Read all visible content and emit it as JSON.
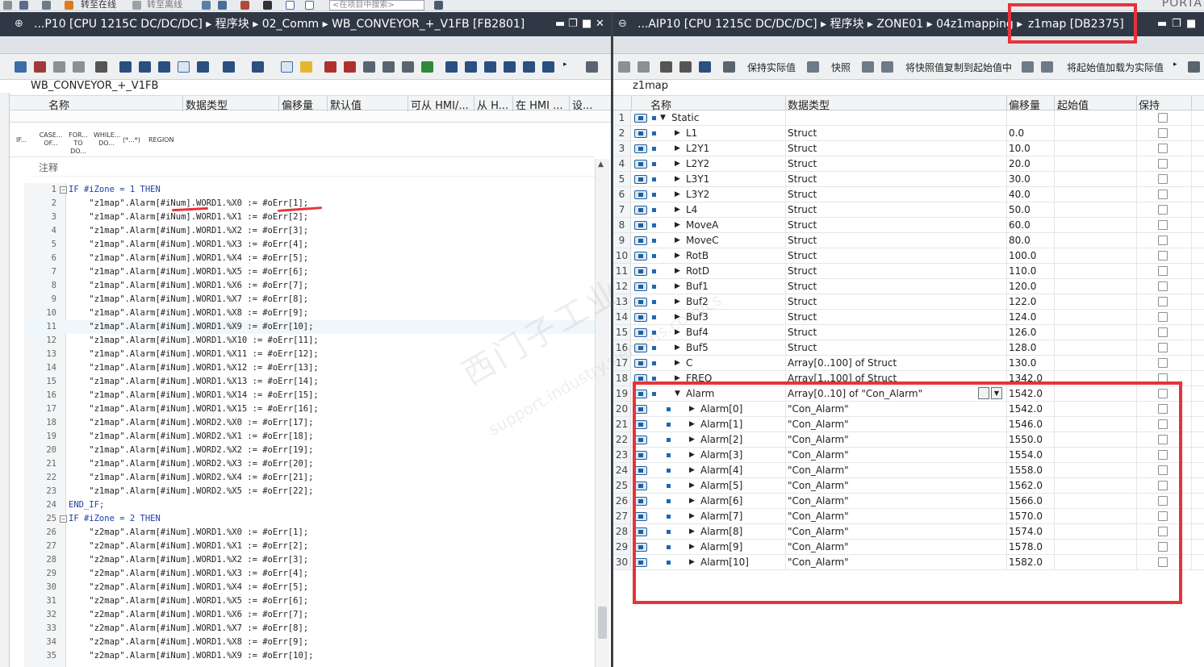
{
  "top_toolbar": {
    "go_online": "转至在线",
    "go_offline": "转至离线",
    "search_placeholder": "<在项目中搜索>",
    "portal": "PORTA"
  },
  "left_pane": {
    "title": "...P10 [CPU 1215C DC/DC/DC] ▸ 程序块 ▸ 02_Comm ▸ WB_CONVEYOR_+_V1FB [FB2801]",
    "block_name": "WB_CONVEYOR_+_V1FB",
    "columns": [
      "名称",
      "数据类型",
      "偏移量",
      "默认值",
      "可从 HMI/...",
      "从 H...",
      "在 HMI ...",
      "设..."
    ],
    "instructions": [
      "IF...",
      "CASE... OF...",
      "FOR... TO DO...",
      "WHILE... DO...",
      "(*...*)",
      "REGION"
    ],
    "comment_label": "注释",
    "code_lines": [
      {
        "n": "1",
        "fold": "−",
        "text": "IF #iZone = 1 THEN",
        "kw": true
      },
      {
        "n": "2",
        "text": "    \"z1map\".Alarm[#iNum].WORD1.%X0 := #oErr[1];"
      },
      {
        "n": "3",
        "text": "    \"z1map\".Alarm[#iNum].WORD1.%X1 := #oErr[2];"
      },
      {
        "n": "4",
        "text": "    \"z1map\".Alarm[#iNum].WORD1.%X2 := #oErr[3];"
      },
      {
        "n": "5",
        "text": "    \"z1map\".Alarm[#iNum].WORD1.%X3 := #oErr[4];"
      },
      {
        "n": "6",
        "text": "    \"z1map\".Alarm[#iNum].WORD1.%X4 := #oErr[5];"
      },
      {
        "n": "7",
        "text": "    \"z1map\".Alarm[#iNum].WORD1.%X5 := #oErr[6];"
      },
      {
        "n": "8",
        "text": "    \"z1map\".Alarm[#iNum].WORD1.%X6 := #oErr[7];"
      },
      {
        "n": "9",
        "text": "    \"z1map\".Alarm[#iNum].WORD1.%X7 := #oErr[8];"
      },
      {
        "n": "10",
        "text": "    \"z1map\".Alarm[#iNum].WORD1.%X8 := #oErr[9];"
      },
      {
        "n": "11",
        "text": "    \"z1map\".Alarm[#iNum].WORD1.%X9 := #oErr[10];",
        "hl": true
      },
      {
        "n": "12",
        "text": "    \"z1map\".Alarm[#iNum].WORD1.%X10 := #oErr[11];"
      },
      {
        "n": "13",
        "text": "    \"z1map\".Alarm[#iNum].WORD1.%X11 := #oErr[12];"
      },
      {
        "n": "14",
        "text": "    \"z1map\".Alarm[#iNum].WORD1.%X12 := #oErr[13];"
      },
      {
        "n": "15",
        "text": "    \"z1map\".Alarm[#iNum].WORD1.%X13 := #oErr[14];"
      },
      {
        "n": "16",
        "text": "    \"z1map\".Alarm[#iNum].WORD1.%X14 := #oErr[15];"
      },
      {
        "n": "17",
        "text": "    \"z1map\".Alarm[#iNum].WORD1.%X15 := #oErr[16];"
      },
      {
        "n": "18",
        "text": "    \"z1map\".Alarm[#iNum].WORD2.%X0 := #oErr[17];"
      },
      {
        "n": "19",
        "text": "    \"z1map\".Alarm[#iNum].WORD2.%X1 := #oErr[18];"
      },
      {
        "n": "20",
        "text": "    \"z1map\".Alarm[#iNum].WORD2.%X2 := #oErr[19];"
      },
      {
        "n": "21",
        "text": "    \"z1map\".Alarm[#iNum].WORD2.%X3 := #oErr[20];"
      },
      {
        "n": "22",
        "text": "    \"z1map\".Alarm[#iNum].WORD2.%X4 := #oErr[21];"
      },
      {
        "n": "23",
        "text": "    \"z1map\".Alarm[#iNum].WORD2.%X5 := #oErr[22];"
      },
      {
        "n": "24",
        "text": "END_IF;",
        "kw": true
      },
      {
        "n": "25",
        "fold": "−",
        "text": "IF #iZone = 2 THEN",
        "kw": true
      },
      {
        "n": "26",
        "text": "    \"z2map\".Alarm[#iNum].WORD1.%X0 := #oErr[1];"
      },
      {
        "n": "27",
        "text": "    \"z2map\".Alarm[#iNum].WORD1.%X1 := #oErr[2];"
      },
      {
        "n": "28",
        "text": "    \"z2map\".Alarm[#iNum].WORD1.%X2 := #oErr[3];"
      },
      {
        "n": "29",
        "text": "    \"z2map\".Alarm[#iNum].WORD1.%X3 := #oErr[4];"
      },
      {
        "n": "30",
        "text": "    \"z2map\".Alarm[#iNum].WORD1.%X4 := #oErr[5];"
      },
      {
        "n": "31",
        "text": "    \"z2map\".Alarm[#iNum].WORD1.%X5 := #oErr[6];"
      },
      {
        "n": "32",
        "text": "    \"z2map\".Alarm[#iNum].WORD1.%X6 := #oErr[7];"
      },
      {
        "n": "33",
        "text": "    \"z2map\".Alarm[#iNum].WORD1.%X7 := #oErr[8];"
      },
      {
        "n": "34",
        "text": "    \"z2map\".Alarm[#iNum].WORD1.%X8 := #oErr[9];"
      },
      {
        "n": "35",
        "text": "    \"z2map\".Alarm[#iNum].WORD1.%X9 := #oErr[10];"
      }
    ]
  },
  "right_pane": {
    "title_prefix": "...AIP10 [CPU 1215C DC/DC/DC] ▸ 程序块 ▸ ZONE01 ▸ 04z1mapping ▸",
    "title_db": "z1map [DB2375]",
    "toolbar": {
      "keep_actual": "保持实际值",
      "snapshot": "快照",
      "copy_snapshot": "将快照值复制到起始值中",
      "load_start": "将起始值加载为实际值"
    },
    "block_name": "z1map",
    "columns": [
      "名称",
      "数据类型",
      "偏移量",
      "起始值",
      "保持"
    ],
    "rows": [
      {
        "n": "1",
        "name": "Static",
        "type": "",
        "offset": "",
        "level": 0,
        "exp": "open"
      },
      {
        "n": "2",
        "name": "L1",
        "type": "Struct",
        "offset": "0.0",
        "level": 1,
        "exp": "closed"
      },
      {
        "n": "3",
        "name": "L2Y1",
        "type": "Struct",
        "offset": "10.0",
        "level": 1,
        "exp": "closed"
      },
      {
        "n": "4",
        "name": "L2Y2",
        "type": "Struct",
        "offset": "20.0",
        "level": 1,
        "exp": "closed"
      },
      {
        "n": "5",
        "name": "L3Y1",
        "type": "Struct",
        "offset": "30.0",
        "level": 1,
        "exp": "closed"
      },
      {
        "n": "6",
        "name": "L3Y2",
        "type": "Struct",
        "offset": "40.0",
        "level": 1,
        "exp": "closed"
      },
      {
        "n": "7",
        "name": "L4",
        "type": "Struct",
        "offset": "50.0",
        "level": 1,
        "exp": "closed"
      },
      {
        "n": "8",
        "name": "MoveA",
        "type": "Struct",
        "offset": "60.0",
        "level": 1,
        "exp": "closed"
      },
      {
        "n": "9",
        "name": "MoveC",
        "type": "Struct",
        "offset": "80.0",
        "level": 1,
        "exp": "closed"
      },
      {
        "n": "10",
        "name": "RotB",
        "type": "Struct",
        "offset": "100.0",
        "level": 1,
        "exp": "closed"
      },
      {
        "n": "11",
        "name": "RotD",
        "type": "Struct",
        "offset": "110.0",
        "level": 1,
        "exp": "closed"
      },
      {
        "n": "12",
        "name": "Buf1",
        "type": "Struct",
        "offset": "120.0",
        "level": 1,
        "exp": "closed"
      },
      {
        "n": "13",
        "name": "Buf2",
        "type": "Struct",
        "offset": "122.0",
        "level": 1,
        "exp": "closed"
      },
      {
        "n": "14",
        "name": "Buf3",
        "type": "Struct",
        "offset": "124.0",
        "level": 1,
        "exp": "closed"
      },
      {
        "n": "15",
        "name": "Buf4",
        "type": "Struct",
        "offset": "126.0",
        "level": 1,
        "exp": "closed"
      },
      {
        "n": "16",
        "name": "Buf5",
        "type": "Struct",
        "offset": "128.0",
        "level": 1,
        "exp": "closed"
      },
      {
        "n": "17",
        "name": "C",
        "type": "Array[0..100] of Struct",
        "offset": "130.0",
        "level": 1,
        "exp": "closed"
      },
      {
        "n": "18",
        "name": "FREQ",
        "type": "Array[1..100] of Struct",
        "offset": "1342.0",
        "level": 1,
        "exp": "closed"
      },
      {
        "n": "19",
        "name": "Alarm",
        "type": "Array[0..10] of \"Con_Alarm\"",
        "offset": "1542.0",
        "level": 1,
        "exp": "open",
        "sel": true
      },
      {
        "n": "20",
        "name": "Alarm[0]",
        "type": "\"Con_Alarm\"",
        "offset": "1542.0",
        "level": 2,
        "exp": "closed"
      },
      {
        "n": "21",
        "name": "Alarm[1]",
        "type": "\"Con_Alarm\"",
        "offset": "1546.0",
        "level": 2,
        "exp": "closed"
      },
      {
        "n": "22",
        "name": "Alarm[2]",
        "type": "\"Con_Alarm\"",
        "offset": "1550.0",
        "level": 2,
        "exp": "closed"
      },
      {
        "n": "23",
        "name": "Alarm[3]",
        "type": "\"Con_Alarm\"",
        "offset": "1554.0",
        "level": 2,
        "exp": "closed"
      },
      {
        "n": "24",
        "name": "Alarm[4]",
        "type": "\"Con_Alarm\"",
        "offset": "1558.0",
        "level": 2,
        "exp": "closed"
      },
      {
        "n": "25",
        "name": "Alarm[5]",
        "type": "\"Con_Alarm\"",
        "offset": "1562.0",
        "level": 2,
        "exp": "closed"
      },
      {
        "n": "26",
        "name": "Alarm[6]",
        "type": "\"Con_Alarm\"",
        "offset": "1566.0",
        "level": 2,
        "exp": "closed"
      },
      {
        "n": "27",
        "name": "Alarm[7]",
        "type": "\"Con_Alarm\"",
        "offset": "1570.0",
        "level": 2,
        "exp": "closed"
      },
      {
        "n": "28",
        "name": "Alarm[8]",
        "type": "\"Con_Alarm\"",
        "offset": "1574.0",
        "level": 2,
        "exp": "closed"
      },
      {
        "n": "29",
        "name": "Alarm[9]",
        "type": "\"Con_Alarm\"",
        "offset": "1578.0",
        "level": 2,
        "exp": "closed"
      },
      {
        "n": "30",
        "name": "Alarm[10]",
        "type": "\"Con_Alarm\"",
        "offset": "1582.0",
        "level": 2,
        "exp": "closed"
      }
    ]
  },
  "watermark": {
    "line1": "西门子工业",
    "line2": "support.industry.siemens.com/cs"
  },
  "colors": {
    "title_bar": "#303846",
    "annotation_red": "#e6333a",
    "keyword_blue": "#1c3fa0"
  }
}
